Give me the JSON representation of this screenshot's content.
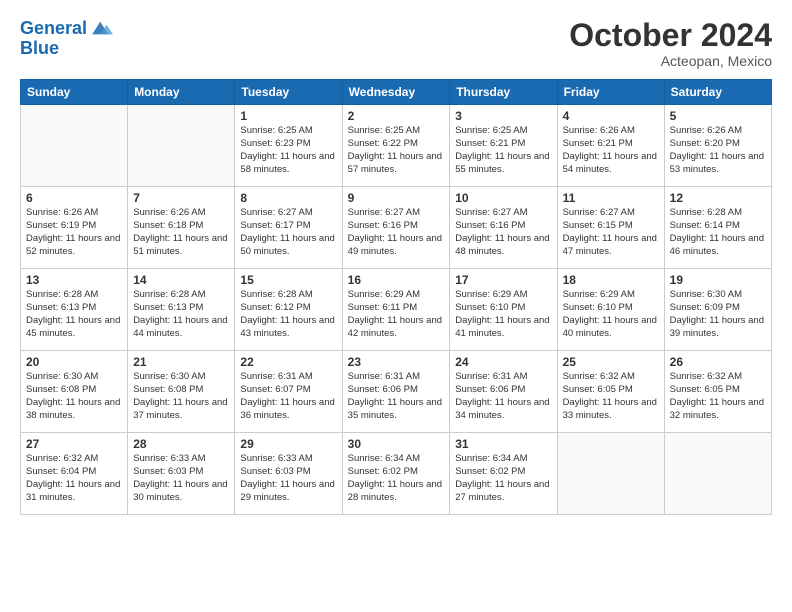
{
  "header": {
    "logo_line1": "General",
    "logo_line2": "Blue",
    "month": "October 2024",
    "location": "Acteopan, Mexico"
  },
  "days_of_week": [
    "Sunday",
    "Monday",
    "Tuesday",
    "Wednesday",
    "Thursday",
    "Friday",
    "Saturday"
  ],
  "weeks": [
    [
      {
        "day": "",
        "empty": true
      },
      {
        "day": "",
        "empty": true
      },
      {
        "day": "1",
        "sunrise": "6:25 AM",
        "sunset": "6:23 PM",
        "daylight": "11 hours and 58 minutes."
      },
      {
        "day": "2",
        "sunrise": "6:25 AM",
        "sunset": "6:22 PM",
        "daylight": "11 hours and 57 minutes."
      },
      {
        "day": "3",
        "sunrise": "6:25 AM",
        "sunset": "6:21 PM",
        "daylight": "11 hours and 55 minutes."
      },
      {
        "day": "4",
        "sunrise": "6:26 AM",
        "sunset": "6:21 PM",
        "daylight": "11 hours and 54 minutes."
      },
      {
        "day": "5",
        "sunrise": "6:26 AM",
        "sunset": "6:20 PM",
        "daylight": "11 hours and 53 minutes."
      }
    ],
    [
      {
        "day": "6",
        "sunrise": "6:26 AM",
        "sunset": "6:19 PM",
        "daylight": "11 hours and 52 minutes."
      },
      {
        "day": "7",
        "sunrise": "6:26 AM",
        "sunset": "6:18 PM",
        "daylight": "11 hours and 51 minutes."
      },
      {
        "day": "8",
        "sunrise": "6:27 AM",
        "sunset": "6:17 PM",
        "daylight": "11 hours and 50 minutes."
      },
      {
        "day": "9",
        "sunrise": "6:27 AM",
        "sunset": "6:16 PM",
        "daylight": "11 hours and 49 minutes."
      },
      {
        "day": "10",
        "sunrise": "6:27 AM",
        "sunset": "6:16 PM",
        "daylight": "11 hours and 48 minutes."
      },
      {
        "day": "11",
        "sunrise": "6:27 AM",
        "sunset": "6:15 PM",
        "daylight": "11 hours and 47 minutes."
      },
      {
        "day": "12",
        "sunrise": "6:28 AM",
        "sunset": "6:14 PM",
        "daylight": "11 hours and 46 minutes."
      }
    ],
    [
      {
        "day": "13",
        "sunrise": "6:28 AM",
        "sunset": "6:13 PM",
        "daylight": "11 hours and 45 minutes."
      },
      {
        "day": "14",
        "sunrise": "6:28 AM",
        "sunset": "6:13 PM",
        "daylight": "11 hours and 44 minutes."
      },
      {
        "day": "15",
        "sunrise": "6:28 AM",
        "sunset": "6:12 PM",
        "daylight": "11 hours and 43 minutes."
      },
      {
        "day": "16",
        "sunrise": "6:29 AM",
        "sunset": "6:11 PM",
        "daylight": "11 hours and 42 minutes."
      },
      {
        "day": "17",
        "sunrise": "6:29 AM",
        "sunset": "6:10 PM",
        "daylight": "11 hours and 41 minutes."
      },
      {
        "day": "18",
        "sunrise": "6:29 AM",
        "sunset": "6:10 PM",
        "daylight": "11 hours and 40 minutes."
      },
      {
        "day": "19",
        "sunrise": "6:30 AM",
        "sunset": "6:09 PM",
        "daylight": "11 hours and 39 minutes."
      }
    ],
    [
      {
        "day": "20",
        "sunrise": "6:30 AM",
        "sunset": "6:08 PM",
        "daylight": "11 hours and 38 minutes."
      },
      {
        "day": "21",
        "sunrise": "6:30 AM",
        "sunset": "6:08 PM",
        "daylight": "11 hours and 37 minutes."
      },
      {
        "day": "22",
        "sunrise": "6:31 AM",
        "sunset": "6:07 PM",
        "daylight": "11 hours and 36 minutes."
      },
      {
        "day": "23",
        "sunrise": "6:31 AM",
        "sunset": "6:06 PM",
        "daylight": "11 hours and 35 minutes."
      },
      {
        "day": "24",
        "sunrise": "6:31 AM",
        "sunset": "6:06 PM",
        "daylight": "11 hours and 34 minutes."
      },
      {
        "day": "25",
        "sunrise": "6:32 AM",
        "sunset": "6:05 PM",
        "daylight": "11 hours and 33 minutes."
      },
      {
        "day": "26",
        "sunrise": "6:32 AM",
        "sunset": "6:05 PM",
        "daylight": "11 hours and 32 minutes."
      }
    ],
    [
      {
        "day": "27",
        "sunrise": "6:32 AM",
        "sunset": "6:04 PM",
        "daylight": "11 hours and 31 minutes."
      },
      {
        "day": "28",
        "sunrise": "6:33 AM",
        "sunset": "6:03 PM",
        "daylight": "11 hours and 30 minutes."
      },
      {
        "day": "29",
        "sunrise": "6:33 AM",
        "sunset": "6:03 PM",
        "daylight": "11 hours and 29 minutes."
      },
      {
        "day": "30",
        "sunrise": "6:34 AM",
        "sunset": "6:02 PM",
        "daylight": "11 hours and 28 minutes."
      },
      {
        "day": "31",
        "sunrise": "6:34 AM",
        "sunset": "6:02 PM",
        "daylight": "11 hours and 27 minutes."
      },
      {
        "day": "",
        "empty": true
      },
      {
        "day": "",
        "empty": true
      }
    ]
  ]
}
